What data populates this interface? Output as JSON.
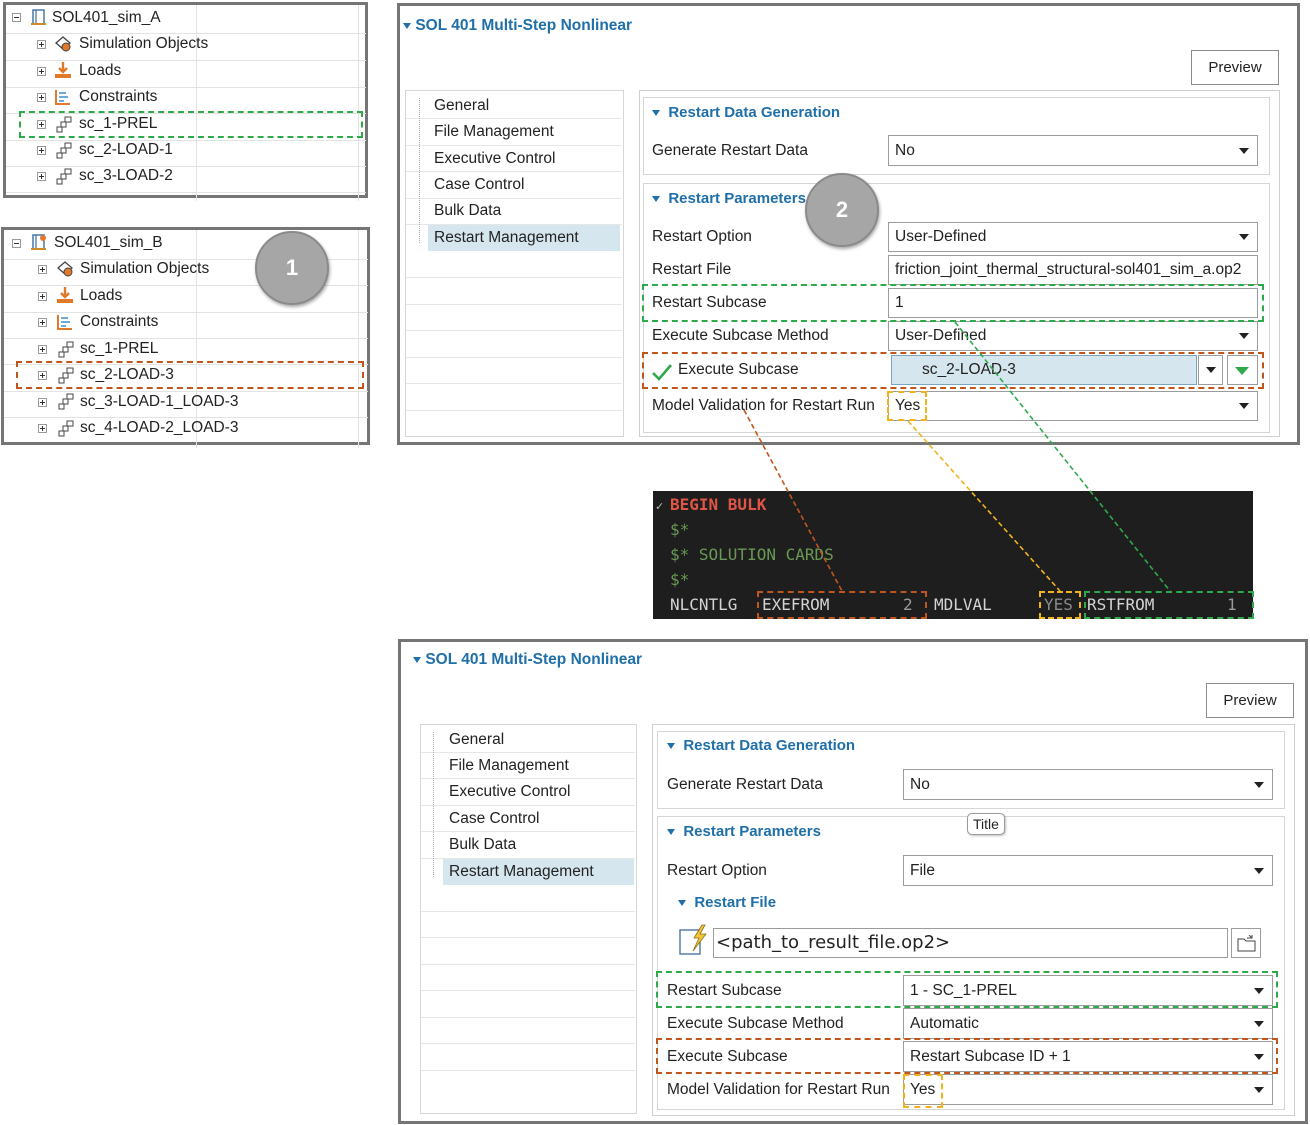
{
  "tree_a": {
    "root": "SOL401_sim_A",
    "items": [
      "Simulation Objects",
      "Loads",
      "Constraints",
      "sc_1-PREL",
      "sc_2-LOAD-1",
      "sc_3-LOAD-2"
    ]
  },
  "tree_b": {
    "root": "SOL401_sim_B",
    "items": [
      "Simulation Objects",
      "Loads",
      "Constraints",
      "sc_1-PREL",
      "sc_2-LOAD-3",
      "sc_3-LOAD-1_LOAD-3",
      "sc_4-LOAD-2_LOAD-3"
    ]
  },
  "badges": {
    "one": "1",
    "two": "2"
  },
  "dialog_top": {
    "title": "SOL 401 Multi-Step Nonlinear",
    "preview": "Preview",
    "nav": [
      "General",
      "File Management",
      "Executive Control",
      "Case Control",
      "Bulk Data",
      "Restart Management"
    ],
    "restart_data_generation": "Restart Data Generation",
    "generate_restart_data_label": "Generate Restart Data",
    "generate_restart_data_value": "No",
    "restart_parameters": "Restart Parameters",
    "restart_option_label": "Restart Option",
    "restart_option_value": "User-Defined",
    "restart_file_label": "Restart File",
    "restart_file_value": "friction_joint_thermal_structural-sol401_sim_a.op2",
    "restart_subcase_label": "Restart Subcase",
    "restart_subcase_value": "1",
    "execute_subcase_method_label": "Execute Subcase Method",
    "execute_subcase_method_value": "User-Defined",
    "execute_subcase_label": "Execute Subcase",
    "execute_subcase_value": "sc_2-LOAD-3",
    "model_validation_label": "Model Validation for Restart Run",
    "model_validation_value": "Yes"
  },
  "code": {
    "line1": "BEGIN BULK",
    "line2": "$*",
    "line3": "$* SOLUTION CARDS",
    "line4": "$*",
    "nlcntlg": "NLCNTLG",
    "exefrom": "EXEFROM",
    "exefrom_value": "2",
    "mdlval": "MDLVAL",
    "mdlval_value": "YES",
    "rstfrom": "RSTFROM",
    "rstfrom_value": "1"
  },
  "dialog_bottom": {
    "title": "SOL 401 Multi-Step Nonlinear",
    "preview": "Preview",
    "nav": [
      "General",
      "File Management",
      "Executive Control",
      "Case Control",
      "Bulk Data",
      "Restart Management"
    ],
    "restart_data_generation": "Restart Data Generation",
    "generate_restart_data_label": "Generate Restart Data",
    "generate_restart_data_value": "No",
    "tooltip": "Title",
    "restart_parameters": "Restart Parameters",
    "restart_option_label": "Restart Option",
    "restart_option_value": "File",
    "restart_file_section": "Restart File",
    "restart_file_path": "<path_to_result_file.op2>",
    "restart_subcase_label": "Restart Subcase",
    "restart_subcase_value": "1 - SC_1-PREL",
    "execute_subcase_method_label": "Execute Subcase Method",
    "execute_subcase_method_value": "Automatic",
    "execute_subcase_label": "Execute Subcase",
    "execute_subcase_value": "Restart Subcase ID + 1",
    "model_validation_label": "Model Validation for Restart Run",
    "model_validation_value": "Yes"
  },
  "colors": {
    "green_dash": "#2eaa4b",
    "orange_dash": "#c0561b",
    "yellow_dash": "#f2b21b",
    "section_blue": "#1f6fa8",
    "code_bg": "#1e1e1e",
    "code_red": "#e05545",
    "code_green": "#6a9955"
  }
}
